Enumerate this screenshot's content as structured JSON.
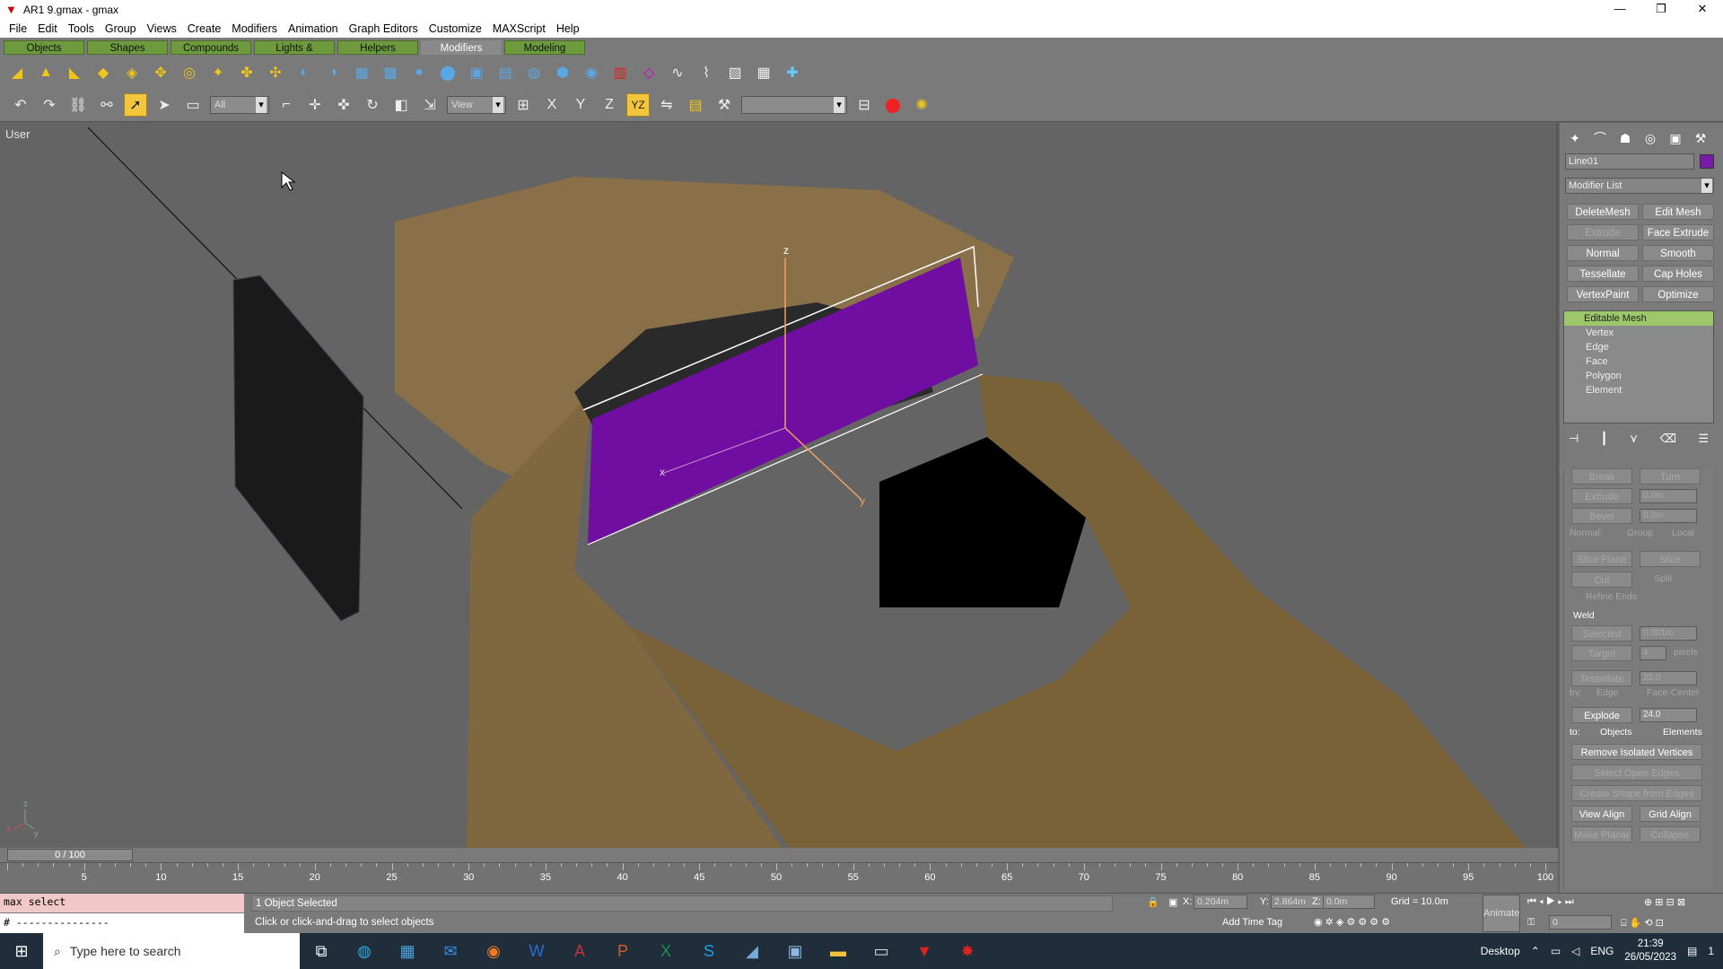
{
  "window": {
    "title": "AR1 9.gmax - gmax",
    "minimize": "—",
    "restore": "❐",
    "close": "✕"
  },
  "menu": [
    "File",
    "Edit",
    "Tools",
    "Group",
    "Views",
    "Create",
    "Modifiers",
    "Animation",
    "Graph Editors",
    "Customize",
    "MAXScript",
    "Help"
  ],
  "tabs": [
    "Objects",
    "Shapes",
    "Compounds",
    "Lights & Cameras",
    "Helpers",
    "Modifiers",
    "Modeling"
  ],
  "active_tab": "Modifiers",
  "toolbar": {
    "selection_filter": "All",
    "reference_coord": "View",
    "named_selection": "",
    "axis_x": "X",
    "axis_y": "Y",
    "axis_z": "Z",
    "axis_yz": "YZ"
  },
  "viewport": {
    "label": "User",
    "axis_z": "z",
    "axis_x": "x",
    "axis_y": "y",
    "gizmo_x": "x",
    "gizmo_y": "y",
    "gizmo_z": "z"
  },
  "command_panel": {
    "object_name": "Line01",
    "object_color": "#7a1aa8",
    "modifier_list": "Modifier List",
    "modifier_buttons": [
      {
        "label": "DeleteMesh",
        "enabled": true
      },
      {
        "label": "Edit Mesh",
        "enabled": true
      },
      {
        "label": "Extrude",
        "enabled": false
      },
      {
        "label": "Face Extrude",
        "enabled": true
      },
      {
        "label": "Normal",
        "enabled": true
      },
      {
        "label": "Smooth",
        "enabled": true
      },
      {
        "label": "Tessellate",
        "enabled": true
      },
      {
        "label": "Cap Holes",
        "enabled": true
      },
      {
        "label": "VertexPaint",
        "enabled": true
      },
      {
        "label": "Optimize",
        "enabled": true
      }
    ],
    "stack": {
      "top": "Editable Mesh",
      "subobjects": [
        "Vertex",
        "Edge",
        "Face",
        "Polygon",
        "Element"
      ]
    },
    "rollout": {
      "break": "Break",
      "turn": "Turn",
      "extrude": "Extrude",
      "extrude_val": "0.0m",
      "bevel": "Bevel",
      "bevel_val": "0.0m",
      "normal": "Normal:",
      "group": "Group",
      "local": "Local",
      "slice_plane": "Slice Plane",
      "slice": "Slice",
      "cut": "Cut",
      "split": "Split",
      "refine_ends": "Refine Ends",
      "weld_title": "Weld",
      "selected": "Selected",
      "selected_val": "0.001m",
      "target": "Target",
      "target_val": "4",
      "pixels": "pixels",
      "tessellate": "Tessellate",
      "tessellate_val": "25.0",
      "by": "by:",
      "edge": "Edge",
      "face_center": "Face-Center",
      "explode": "Explode",
      "explode_val": "24.0",
      "to": "to:",
      "objects": "Objects",
      "elements": "Elements",
      "remove_isolated": "Remove Isolated Vertices",
      "select_open_edges": "Select Open Edges",
      "create_shape": "Create Shape from Edges",
      "view_align": "View Align",
      "grid_align": "Grid Align",
      "make_planar": "Make Planar",
      "collapse": "Collapse"
    }
  },
  "timeline": {
    "position": "0 / 100",
    "ticks": [
      "5",
      "10",
      "15",
      "20",
      "25",
      "30",
      "35",
      "40",
      "45",
      "50",
      "55",
      "60",
      "65",
      "70",
      "75",
      "80",
      "85",
      "90",
      "95",
      "100"
    ]
  },
  "status": {
    "listener_input": "max select",
    "listener_output": "# ---------------",
    "selection": "1 Object Selected",
    "prompt": "Click or click-and-drag to select objects",
    "x_label": "X:",
    "x_val": "0.204m",
    "y_label": "Y:",
    "y_val": "2.864m",
    "z_label": "Z:",
    "z_val": "0.0m",
    "grid": "Grid = 10.0m",
    "add_time_tag": "Add Time Tag",
    "animate": "Animate",
    "frame": "0"
  },
  "taskbar": {
    "search_placeholder": "Type here to search",
    "desktop": "Desktop",
    "lang": "ENG",
    "time": "21:39",
    "date": "26/05/2023",
    "notif_count": "1"
  }
}
